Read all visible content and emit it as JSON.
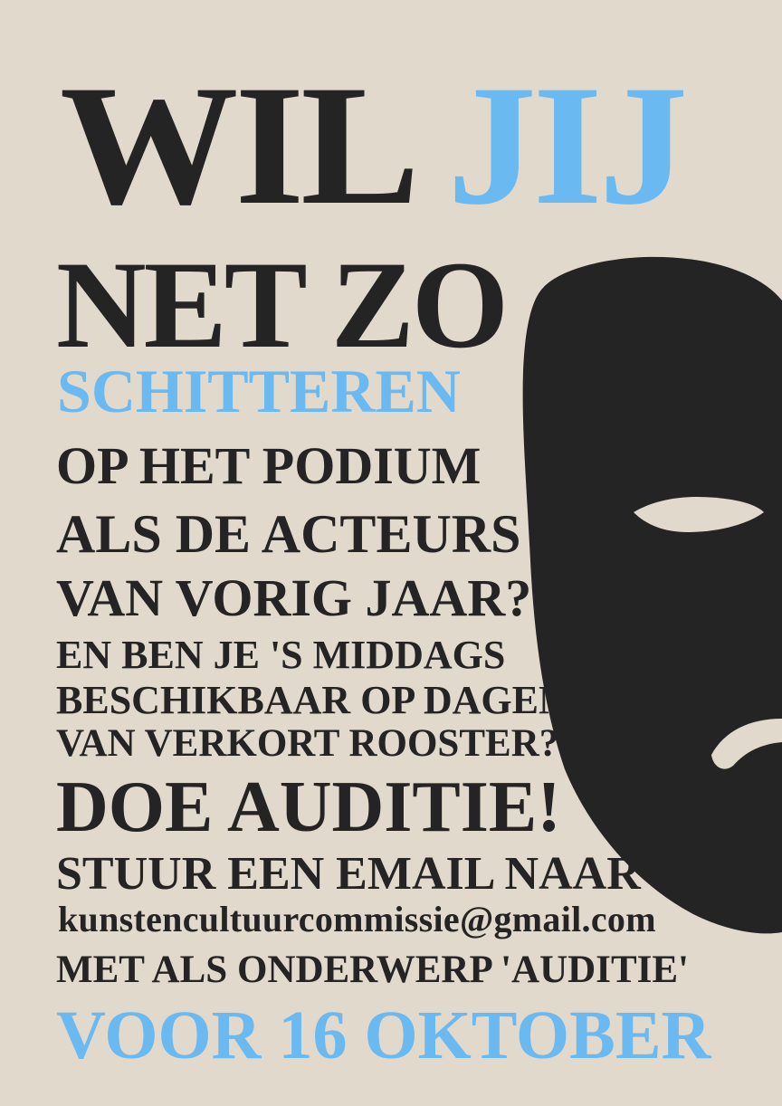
{
  "poster": {
    "line1_part1": "WIL",
    "line1_part2": "JIJ",
    "line2": "NET ZO",
    "line3": "SCHITTEREN",
    "line4": "OP HET PODIUM",
    "line5": "ALS DE ACTEURS",
    "line6": "VAN VORIG JAAR?",
    "line7": "EN BEN JE 'S MIDDAGS",
    "line8": "BESCHIKBAAR OP DAGEN",
    "line9": "VAN VERKORT ROOSTER?",
    "line10": "DOE AUDITIE!",
    "line11": "STUUR EEN EMAIL NAAR",
    "email": "kunstencultuurcommissie@gmail.com",
    "line13": "MET ALS ONDERWERP 'AUDITIE'",
    "line14": "VOOR 16 OKTOBER"
  },
  "colors": {
    "background": "#e1d9cc",
    "text": "#242424",
    "accent": "#6ab9f1",
    "mask": "#242424"
  },
  "icons": {
    "mask": "theatre-mask-icon"
  }
}
